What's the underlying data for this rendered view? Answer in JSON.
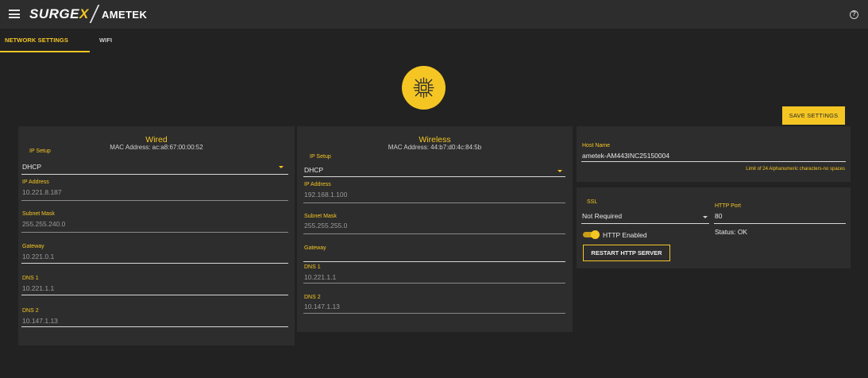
{
  "header": {
    "logo_surgex": "SURGE",
    "logo_surgex_x": "X",
    "logo_ametek": "AMETEK",
    "help_symbol": "?"
  },
  "tabs": [
    {
      "label": "NETWORK SETTINGS",
      "active": true
    },
    {
      "label": "WIFI",
      "active": false
    }
  ],
  "colors": {
    "accent": "#f5c623",
    "background": "#222222",
    "card": "#2d2d2d"
  },
  "icons": {
    "menu": "hamburger-menu-icon",
    "help": "help-circle-icon",
    "network": "network-chip-icon",
    "dropdown": "caret-down-icon"
  },
  "save_button": "SAVE SETTINGS",
  "wired": {
    "title": "Wired",
    "mac": "MAC Address: ac:a8:67:00:00:52",
    "ip_setup_label": "IP Setup",
    "ip_setup_value": "DHCP",
    "ip_address_label": "IP Address",
    "ip_address": "10.221.8.187",
    "subnet_label": "Subnet Mask",
    "subnet": "255.255.240.0",
    "gateway_label": "Gateway",
    "gateway": "10.221.0.1",
    "dns1_label": "DNS 1",
    "dns1": "10.221.1.1",
    "dns2_label": "DNS 2",
    "dns2": "10.147.1.13"
  },
  "wireless": {
    "title": "Wireless",
    "mac": "MAC Address: 44:b7:d0:4c:84:5b",
    "ip_setup_label": "IP Setup",
    "ip_setup_value": "DHCP",
    "ip_address_label": "IP Address",
    "ip_address": "192.168.1.100",
    "subnet_label": "Subnet Mask",
    "subnet": "255.255.255.0",
    "gateway_label": "Gateway",
    "gateway": "",
    "dns1_label": "DNS 1",
    "dns1": "10.221.1.1",
    "dns2_label": "DNS 2",
    "dns2": "10.147.1.13"
  },
  "host": {
    "label": "Host Name",
    "value": "ametek-AM443INC25150004",
    "hint": "Limit of 24 Alphanumeric characters-no spaces"
  },
  "http": {
    "ssl_label": "SSL",
    "ssl_value": "Not Required",
    "port_label": "HTTP Port",
    "port_value": "80",
    "status": "Status: OK",
    "toggle_label": "HTTP Enabled",
    "toggle_on": true,
    "restart_button": "RESTART HTTP SERVER"
  }
}
